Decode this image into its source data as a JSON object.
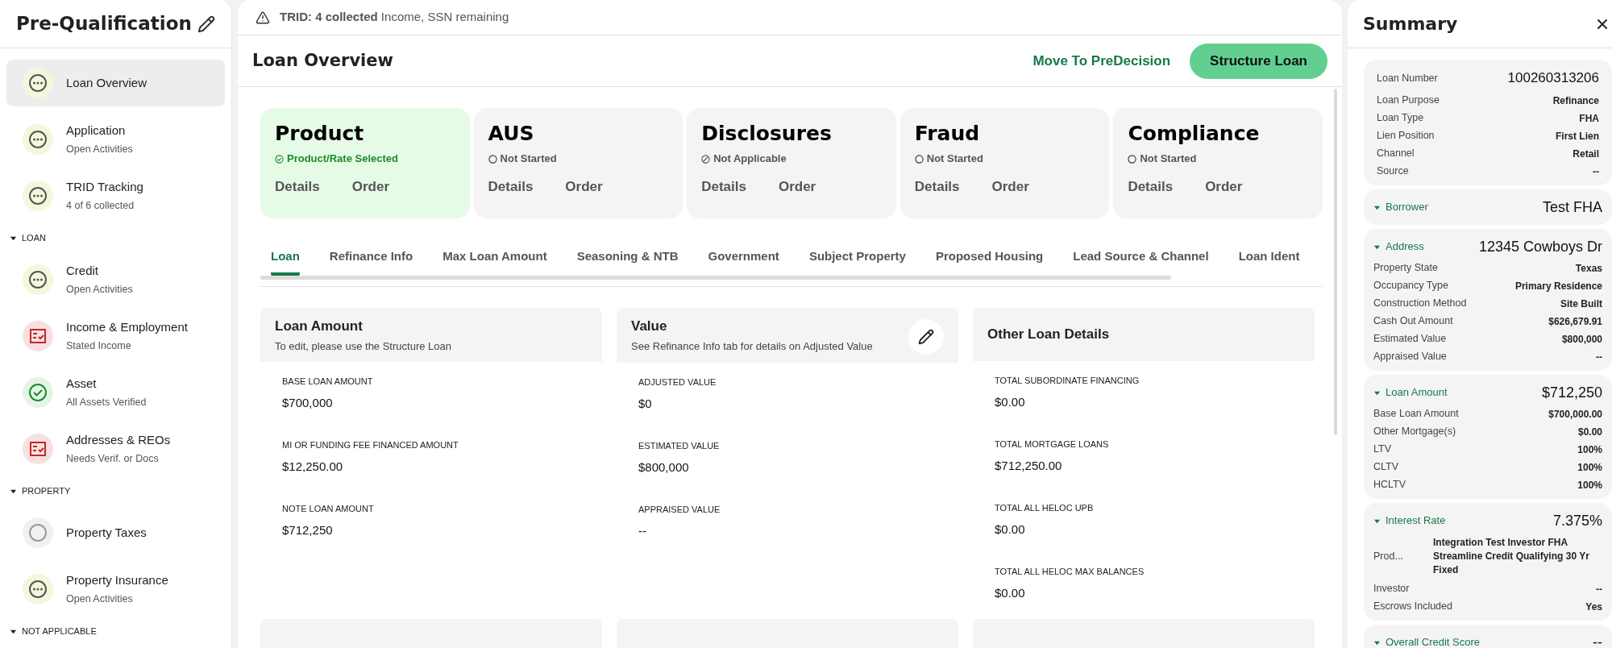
{
  "sidebar": {
    "title": "Pre-Qualification",
    "sections": [
      {
        "items": [
          {
            "label": "Loan Overview",
            "kind": "pending",
            "selected": true
          },
          {
            "label": "Application",
            "sub": "Open Activities",
            "kind": "pending",
            "selected": false
          },
          {
            "label": "TRID Tracking",
            "sub": "4 of 6 collected",
            "kind": "pending",
            "selected": false
          }
        ]
      },
      {
        "label": "LOAN",
        "expanded": true,
        "items": [
          {
            "label": "Credit",
            "sub": "Open Activities",
            "kind": "pending",
            "selected": false
          },
          {
            "label": "Income & Employment",
            "sub": "Stated Income",
            "kind": "attention",
            "selected": false
          },
          {
            "label": "Asset",
            "sub": "All Assets Verified",
            "kind": "done",
            "selected": false
          },
          {
            "label": "Addresses & REOs",
            "sub": "Needs Verif. or Docs",
            "kind": "attention",
            "selected": false
          }
        ]
      },
      {
        "label": "PROPERTY",
        "expanded": true,
        "items": [
          {
            "label": "Property Taxes",
            "kind": "empty",
            "selected": false
          },
          {
            "label": "Property Insurance",
            "sub": "Open Activities",
            "kind": "pending",
            "selected": false
          }
        ]
      },
      {
        "label": "NOT APPLICABLE",
        "expanded": true
      }
    ]
  },
  "alert": {
    "text": "**TRID: 4 collected** Income, SSN remaining"
  },
  "header": {
    "title": "Loan Overview",
    "link": "Move To PreDecision",
    "button": "Structure Loan"
  },
  "cards": [
    {
      "title": "Product",
      "status": "Product/Rate Selected",
      "kind": "done",
      "actions": [
        "Details",
        "Order"
      ]
    },
    {
      "title": "AUS",
      "status": "Not Started",
      "kind": "not_started",
      "actions": [
        "Details",
        "Order"
      ]
    },
    {
      "title": "Disclosures",
      "status": "Not Applicable",
      "kind": "not_applicable",
      "actions": [
        "Details",
        "Order"
      ]
    },
    {
      "title": "Fraud",
      "status": "Not Started",
      "kind": "not_started",
      "actions": [
        "Details",
        "Order"
      ]
    },
    {
      "title": "Compliance",
      "status": "Not Started",
      "kind": "not_started",
      "actions": [
        "Details",
        "Order"
      ]
    }
  ],
  "tabs": [
    {
      "label": "Loan",
      "selected": true
    },
    {
      "label": "Refinance Info",
      "selected": false
    },
    {
      "label": "Max Loan Amount",
      "selected": false
    },
    {
      "label": "Seasoning & NTB",
      "selected": false
    },
    {
      "label": "Government",
      "selected": false
    },
    {
      "label": "Subject Property",
      "selected": false
    },
    {
      "label": "Proposed Housing",
      "selected": false
    },
    {
      "label": "Lead Source & Channel",
      "selected": false
    },
    {
      "label": "Loan Ident",
      "selected": false
    }
  ],
  "panels": [
    {
      "title": "Loan Amount",
      "subtitle": "To edit, please use the Structure Loan",
      "editable": false,
      "fields": [
        {
          "label": "BASE LOAN AMOUNT",
          "value": "$700,000"
        },
        {
          "label": "MI OR FUNDING FEE FINANCED AMOUNT",
          "value": "$12,250.00"
        },
        {
          "label": "NOTE LOAN AMOUNT",
          "value": "$712,250"
        }
      ]
    },
    {
      "title": "Value",
      "subtitle": "See Refinance Info tab for details on Adjusted Value",
      "editable": true,
      "fields": [
        {
          "label": "ADJUSTED VALUE",
          "value": "$0"
        },
        {
          "label": "ESTIMATED VALUE",
          "value": "$800,000"
        },
        {
          "label": "APPRAISED VALUE",
          "value": "--"
        }
      ]
    },
    {
      "title": "Other Loan Details",
      "editable": false,
      "fields": [
        {
          "label": "TOTAL SUBORDINATE FINANCING",
          "value": "$0.00"
        },
        {
          "label": "TOTAL MORTGAGE LOANS",
          "value": "$712,250.00"
        },
        {
          "label": "TOTAL ALL HELOC UPB",
          "value": "$0.00"
        },
        {
          "label": "TOTAL ALL HELOC MAX BALANCES",
          "value": "$0.00"
        }
      ]
    }
  ],
  "summary": {
    "title": "Summary",
    "groups": [
      {
        "rows": [
          {
            "label": "Loan Number",
            "value": "100260313206",
            "kind": "large"
          },
          {
            "label": "Loan Purpose",
            "value": "Refinance",
            "kind": "bold"
          },
          {
            "label": "Loan Type",
            "value": "FHA",
            "kind": "bold"
          },
          {
            "label": "Lien Position",
            "value": "First Lien",
            "kind": "bold"
          },
          {
            "label": "Channel",
            "value": "Retail",
            "kind": "bold"
          },
          {
            "label": "Source",
            "value": "--",
            "kind": "bold"
          }
        ]
      },
      {
        "label": "Borrower",
        "value": "Test FHA",
        "expanded": true
      },
      {
        "label": "Address",
        "value": "12345 Cowboys Dr",
        "expanded": true,
        "rows": [
          {
            "label": "Property State",
            "value": "Texas",
            "kind": "bold"
          },
          {
            "label": "Occupancy Type",
            "value": "Primary Residence",
            "kind": "bold"
          },
          {
            "label": "Construction Method",
            "value": "Site Built",
            "kind": "bold"
          },
          {
            "label": "Cash Out Amount",
            "value": "$626,679.91",
            "kind": "bold"
          },
          {
            "label": "Estimated Value",
            "value": "$800,000",
            "kind": "bold"
          },
          {
            "label": "Appraised Value",
            "value": "--",
            "kind": "bold"
          }
        ]
      },
      {
        "label": "Loan Amount",
        "value": "$712,250",
        "expanded": true,
        "rows": [
          {
            "label": "Base Loan Amount",
            "value": "$700,000.00",
            "kind": "bold"
          },
          {
            "label": "Other Mortgage(s)",
            "value": "$0.00",
            "kind": "bold"
          },
          {
            "label": "LTV",
            "value": "100%",
            "kind": "bold"
          },
          {
            "label": "CLTV",
            "value": "100%",
            "kind": "bold"
          },
          {
            "label": "HCLTV",
            "value": "100%",
            "kind": "bold"
          }
        ]
      },
      {
        "label": "Interest Rate",
        "value": "7.375%",
        "expanded": true,
        "rows": [
          {
            "label": "Prod...",
            "value": "Integration Test Investor FHA Streamline Credit Qualifying 30 Yr Fixed",
            "kind": "multiline"
          },
          {
            "label": "Investor",
            "value": "--",
            "kind": "bold"
          },
          {
            "label": "Escrows Included",
            "value": "Yes",
            "kind": "bold"
          }
        ]
      },
      {
        "label": "Overall Credit Score",
        "value": "--",
        "expanded": true
      }
    ]
  }
}
